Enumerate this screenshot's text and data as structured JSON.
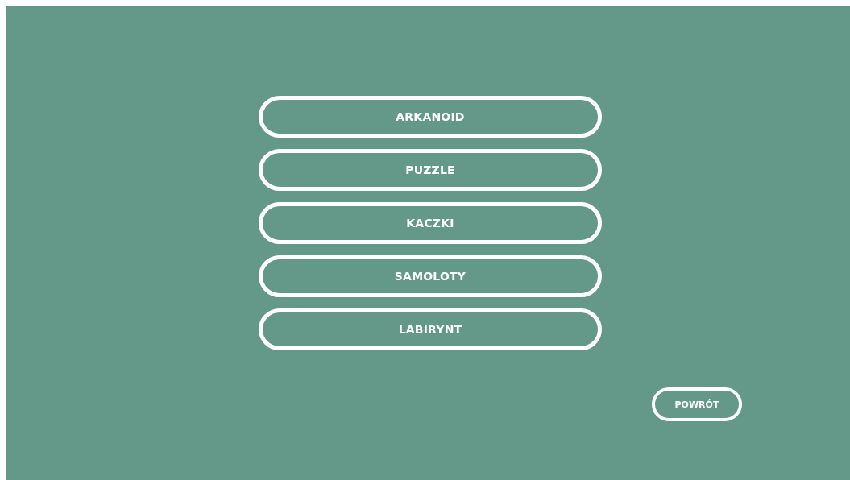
{
  "menu": [
    {
      "label": "ARKANOID"
    },
    {
      "label": "PUZZLE"
    },
    {
      "label": "KACZKI"
    },
    {
      "label": "SAMOLOTY"
    },
    {
      "label": "LABIRYNT"
    }
  ],
  "back_button": {
    "label": "POWRÓT"
  }
}
